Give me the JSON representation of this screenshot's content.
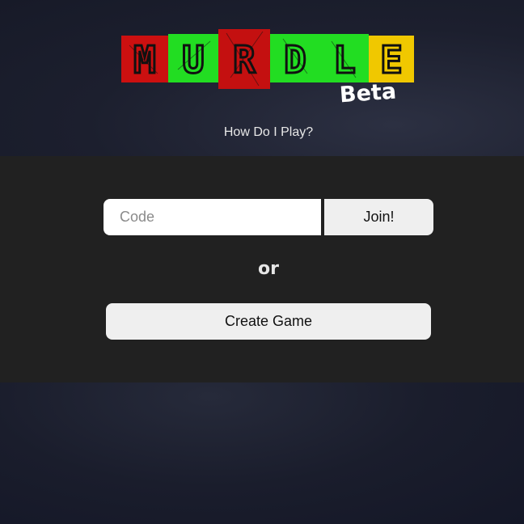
{
  "header": {
    "logo": {
      "letters": [
        "M",
        "U",
        "R",
        "D",
        "L",
        "E"
      ],
      "tile_colors": [
        "#cc1010",
        "#22dd22",
        "#cc1010",
        "#22dd22",
        "#22dd22",
        "#f0c800"
      ]
    },
    "beta_label": "Beta",
    "how_to_play_link": "How Do I Play?"
  },
  "join": {
    "code_placeholder": "Code",
    "code_value": "",
    "join_button": "Join!"
  },
  "separator": "or",
  "create_game_button": "Create Game"
}
